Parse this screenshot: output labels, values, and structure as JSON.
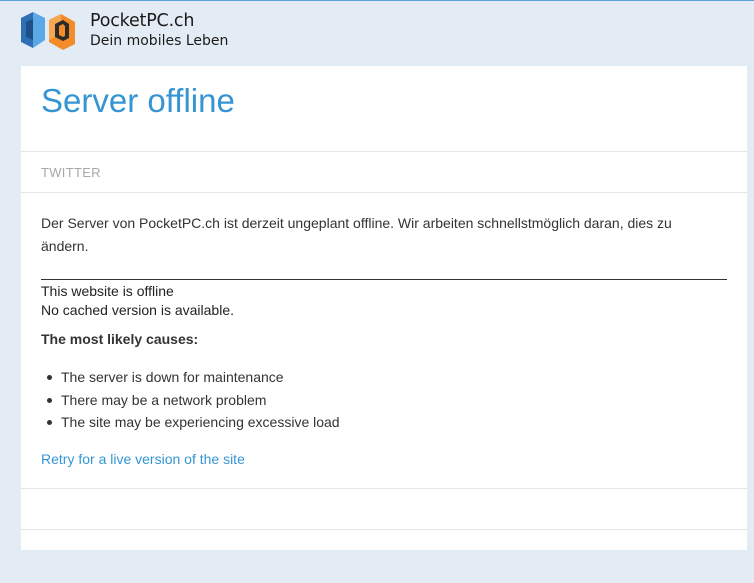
{
  "header": {
    "brand_name": "PocketPC.ch",
    "tagline": "Dein mobiles Leben",
    "logo_icon": "pocketpc-logo-icon",
    "colors": {
      "logo_blue": "#2e6fb5",
      "logo_light_blue": "#5aa9e6",
      "logo_orange": "#f28c28",
      "logo_dark": "#2b2b2b"
    }
  },
  "main": {
    "title": "Server offline",
    "twitter_label": "TWITTER",
    "intro_text": "Der Server von PocketPC.ch ist derzeit ungeplant offline. Wir arbeiten schnellstmöglich daran, dies zu ändern.",
    "offline_title": "This website is offline",
    "no_cache_text": "No cached version is available.",
    "causes_heading": "The most likely causes:",
    "causes": [
      "The server is down for maintenance",
      "There may be a network problem",
      "The site may be experiencing excessive load"
    ],
    "retry_link": "Retry for a live version of the site"
  },
  "colors": {
    "accent": "#3595d3",
    "page_background": "#e3ebf4",
    "card_background": "#ffffff",
    "muted_text": "#a8a8a8",
    "body_text": "#333333"
  }
}
